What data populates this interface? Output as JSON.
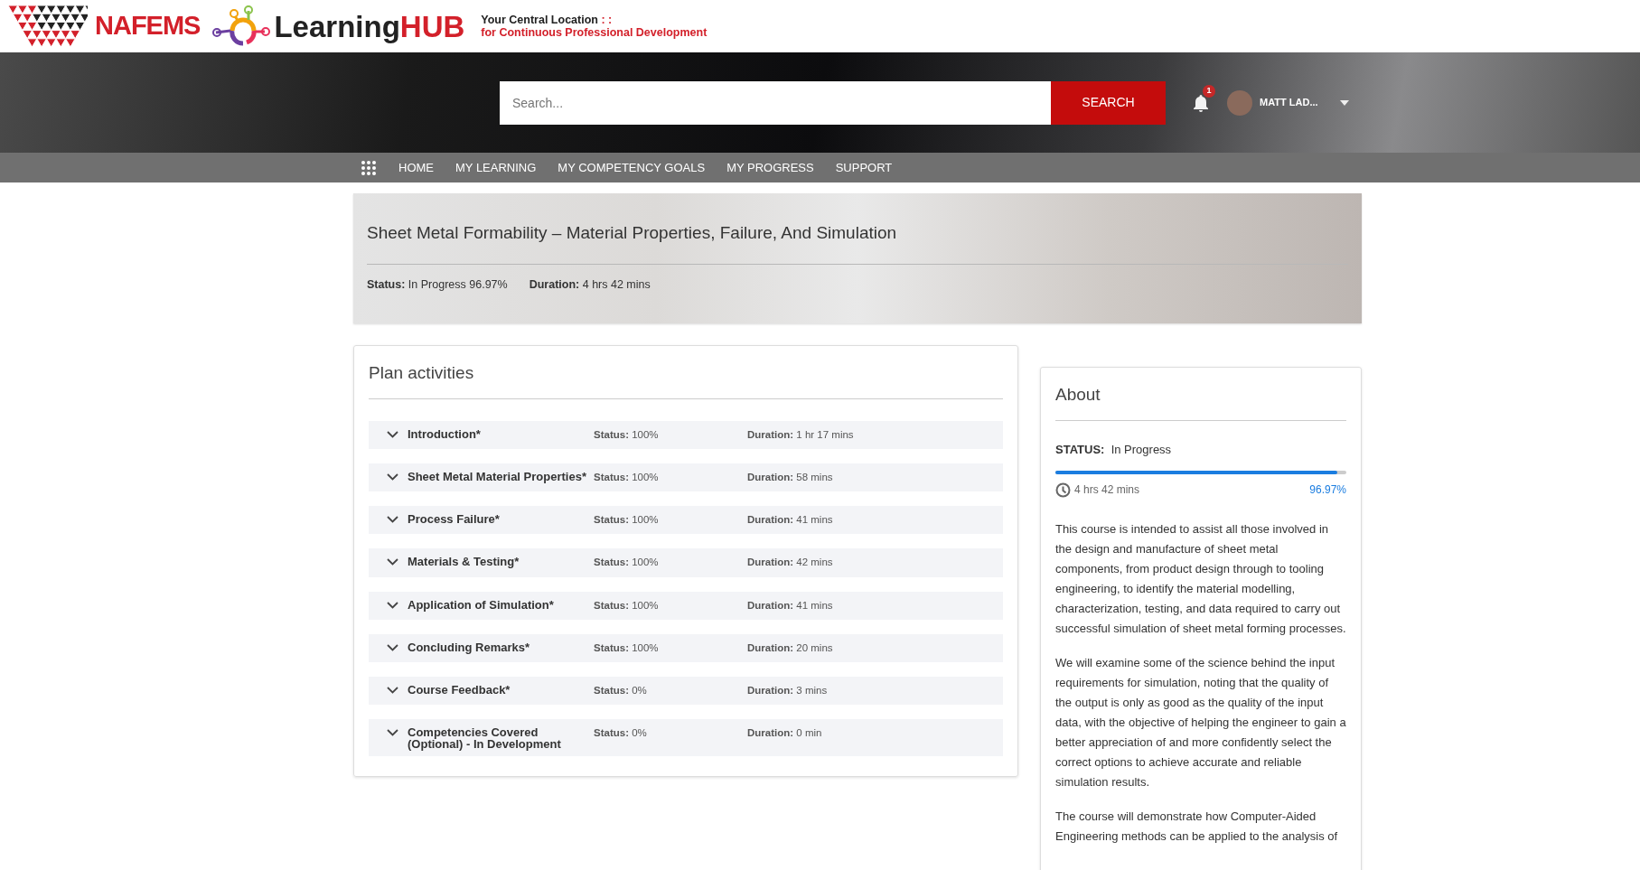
{
  "logo": {
    "brand": "NAFEMS",
    "hub_left": "Learning",
    "hub_right": "HUB",
    "tagline_top": "Your Central Location",
    "tagline_sep": ": :",
    "tagline_bottom": "for Continuous Professional Development"
  },
  "search": {
    "placeholder": "Search...",
    "button": "SEARCH"
  },
  "user": {
    "notifications": "1",
    "name": "MATT LAD..."
  },
  "nav": [
    {
      "label": "HOME"
    },
    {
      "label": "MY LEARNING"
    },
    {
      "label": "MY COMPETENCY GOALS"
    },
    {
      "label": "MY PROGRESS"
    },
    {
      "label": "SUPPORT"
    }
  ],
  "course": {
    "title": "Sheet Metal Formability – Material Properties, Failure, And Simulation",
    "status_label": "Status:",
    "status": "In Progress 96.97%",
    "duration_label": "Duration:",
    "duration": "4 hrs 42 mins"
  },
  "plan": {
    "title": "Plan activities",
    "activities": [
      {
        "name": "Introduction*",
        "status_label": "Status:",
        "status": "100%",
        "duration_label": "Duration:",
        "duration": "1 hr 17 mins"
      },
      {
        "name": "Sheet Metal Material Properties*",
        "status_label": "Status:",
        "status": "100%",
        "duration_label": "Duration:",
        "duration": "58 mins"
      },
      {
        "name": "Process Failure*",
        "status_label": "Status:",
        "status": "100%",
        "duration_label": "Duration:",
        "duration": "41 mins"
      },
      {
        "name": "Materials & Testing*",
        "status_label": "Status:",
        "status": "100%",
        "duration_label": "Duration:",
        "duration": "42 mins"
      },
      {
        "name": "Application of Simulation*",
        "status_label": "Status:",
        "status": "100%",
        "duration_label": "Duration:",
        "duration": "41 mins"
      },
      {
        "name": "Concluding Remarks*",
        "status_label": "Status:",
        "status": "100%",
        "duration_label": "Duration:",
        "duration": "20 mins"
      },
      {
        "name": "Course Feedback*",
        "status_label": "Status:",
        "status": "0%",
        "duration_label": "Duration:",
        "duration": "3 mins"
      },
      {
        "name": "Competencies Covered (Optional) - In Development",
        "status_label": "Status:",
        "status": "0%",
        "duration_label": "Duration:",
        "duration": "0 min"
      }
    ]
  },
  "about": {
    "title": "About",
    "status_label": "STATUS:",
    "status": "In Progress",
    "level": 0.9697,
    "duration": "4 hrs 42 mins",
    "percent": "96.97%",
    "paragraphs": [
      "This course is intended to assist all those involved in the design and manufacture of sheet metal components, from product design through to tooling engineering, to identify the material modelling, characterization, testing, and data required to carry out successful simulation of sheet metal forming processes.",
      "We will examine some of the science behind the input requirements for simulation, noting that the quality of the output is only as good as the quality of the input data, with the objective of helping the engineer to gain a better appreciation of and more confidently select the correct options to achieve accurate and reliable simulation results.",
      "The course will demonstrate how Computer-Aided Engineering methods can be applied to the analysis of"
    ]
  }
}
